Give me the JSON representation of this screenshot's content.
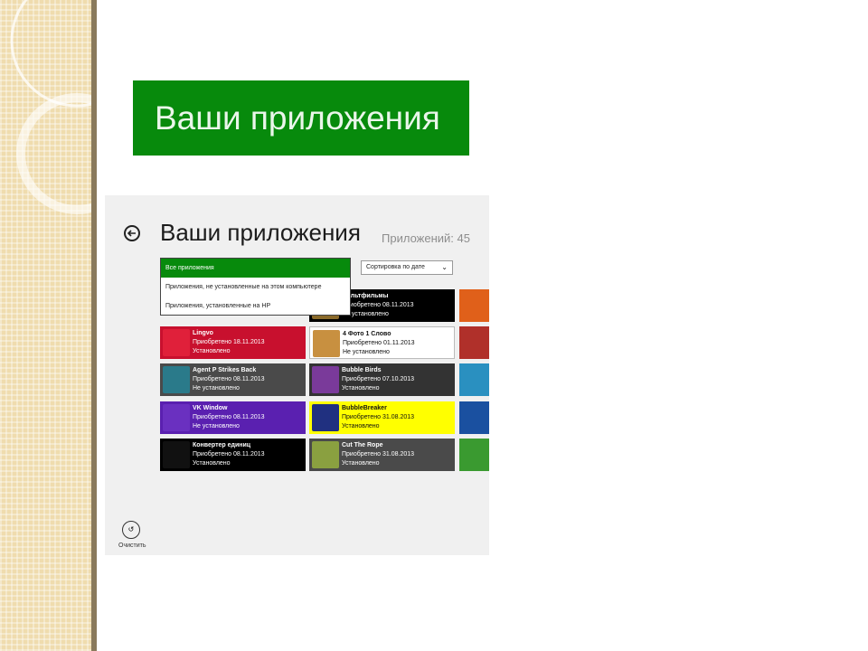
{
  "slide_title": "Ваши приложения",
  "screenshot": {
    "page_title": "Ваши приложения",
    "app_count": "Приложений: 45",
    "filter_options": [
      "Все приложения",
      "Приложения, не установленные на этом компьютере",
      "Приложения, установленные на HP"
    ],
    "sort_label": "Сортировка по дате",
    "apps": [
      {
        "name": "Мультфильмы",
        "date": "Приобретено 08.11.2013",
        "status": "Не установлено",
        "color": "#000000",
        "icon_color": "#8a6a2a"
      },
      {
        "name": "Lingvo",
        "date": "Приобретено 18.11.2013",
        "status": "Установлено",
        "color": "#c8102e",
        "icon_color": "#e0203a"
      },
      {
        "name": "4 Фото 1 Слово",
        "date": "Приобретено 01.11.2013",
        "status": "Не установлено",
        "color": "#ffffff",
        "icon_color": "#c89040"
      },
      {
        "name": "Agent P Strikes Back",
        "date": "Приобретено 08.11.2013",
        "status": "Не установлено",
        "color": "#4a4a4a",
        "icon_color": "#2a7a8a"
      },
      {
        "name": "Bubble Birds",
        "date": "Приобретено 07.10.2013",
        "status": "Установлено",
        "color": "#333333",
        "icon_color": "#7a3a9a"
      },
      {
        "name": "VK Window",
        "date": "Приобретено 08.11.2013",
        "status": "Не установлено",
        "color": "#5a20b0",
        "icon_color": "#6a30c0"
      },
      {
        "name": "BubbleBreaker",
        "date": "Приобретено 31.08.2013",
        "status": "Установлено",
        "color": "#ffff00",
        "icon_color": "#203080"
      },
      {
        "name": "Конвертер единиц",
        "date": "Приобретено 08.11.2013",
        "status": "Установлено",
        "color": "#000000",
        "icon_color": "#111111"
      },
      {
        "name": "Cut The Rope",
        "date": "Приобретено 31.08.2013",
        "status": "Установлено",
        "color": "#4a4a4a",
        "icon_color": "#8aa040"
      }
    ],
    "clear_label": "Очистить"
  }
}
